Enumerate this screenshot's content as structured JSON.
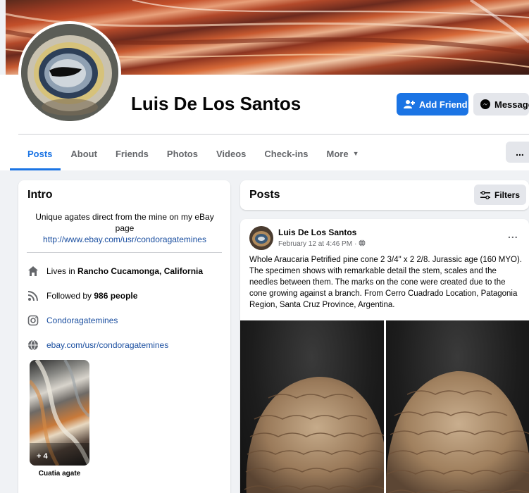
{
  "profile": {
    "name": "Luis De Los Santos",
    "add_friend_label": "Add Friend",
    "message_label": "Message"
  },
  "tabs": [
    {
      "label": "Posts",
      "active": true
    },
    {
      "label": "About"
    },
    {
      "label": "Friends"
    },
    {
      "label": "Photos"
    },
    {
      "label": "Videos"
    },
    {
      "label": "Check-ins"
    },
    {
      "label": "More"
    }
  ],
  "more_menu_label": "...",
  "intro": {
    "title": "Intro",
    "bio": "Unique agates direct from the mine on my eBay page",
    "bio_link": "http://www.ebay.com/usr/condoragatemines",
    "lives_prefix": "Lives in ",
    "lives_place": "Rancho Cucamonga, California",
    "followed_prefix": "Followed by ",
    "followed_count": "986 people",
    "instagram": "Condoragatemines",
    "website": "ebay.com/usr/condoragatemines",
    "featured_count": "+ 4",
    "featured_caption": "Cuatia agate"
  },
  "posts_section": {
    "title": "Posts",
    "filters_label": "Filters"
  },
  "post": {
    "author": "Luis De Los Santos",
    "date": "February 12 at 4:46 PM",
    "dot": "·",
    "options": "...",
    "text": "Whole Araucaria Petrified pine cone 2 3/4\" x 2 2/8. Jurassic age (160 MYO). The specimen shows with remarkable detail the stem, scales and the needles between them. The marks on the cone were created due to the cone growing against a branch. From Cerro Cuadrado Location, Patagonia Region, Santa Cruz Province, Argentina."
  },
  "colors": {
    "accent": "#1b74e4",
    "link": "#1b4fa0",
    "page_bg": "#f0f2f5"
  }
}
